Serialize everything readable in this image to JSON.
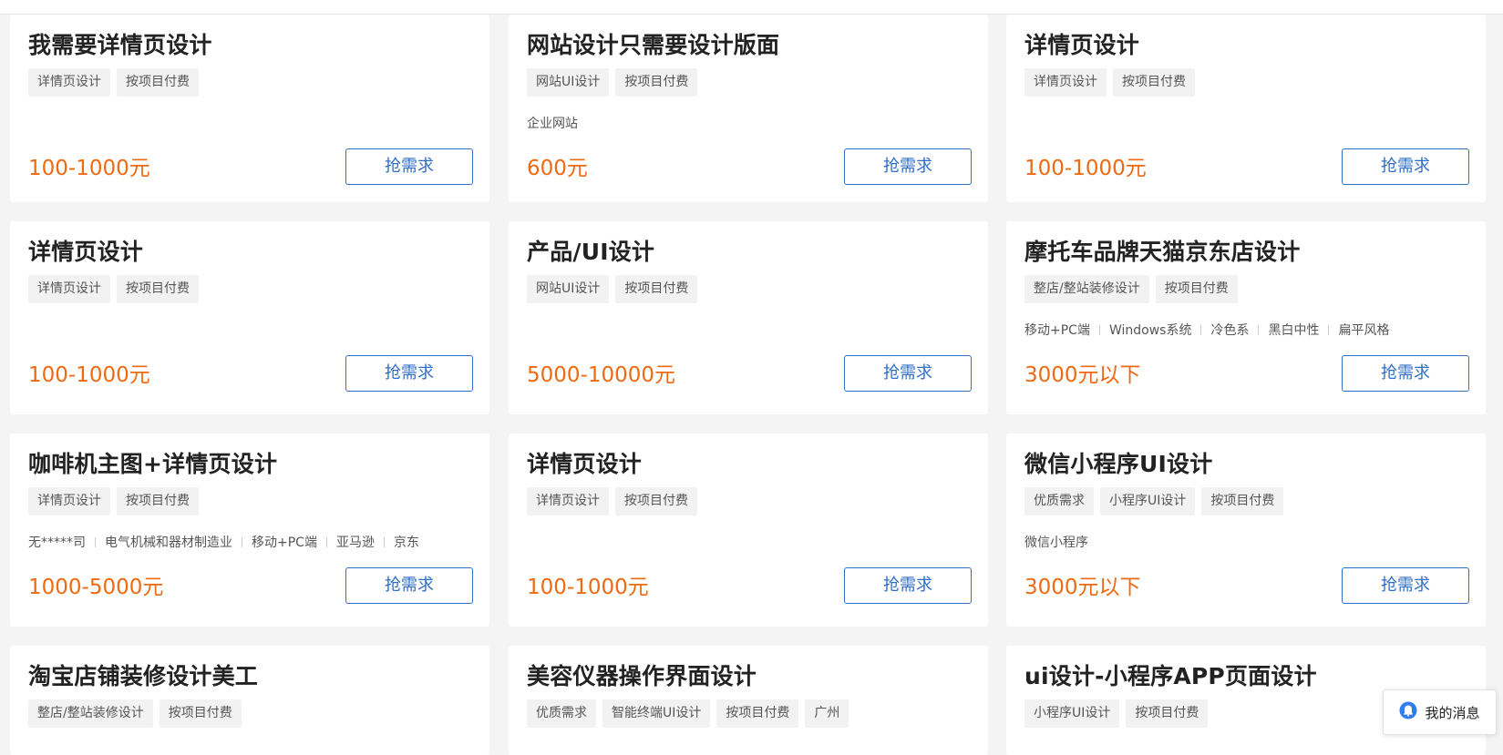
{
  "grab_label": "抢需求",
  "cards": [
    {
      "title": "我需要详情页设计",
      "tags": [
        "详情页设计",
        "按项目付费"
      ],
      "info": [],
      "price": "100-1000元"
    },
    {
      "title": "网站设计只需要设计版面",
      "tags": [
        "网站UI设计",
        "按项目付费"
      ],
      "info": [
        "企业网站"
      ],
      "price": "600元"
    },
    {
      "title": "详情页设计",
      "tags": [
        "详情页设计",
        "按项目付费"
      ],
      "info": [],
      "price": "100-1000元"
    },
    {
      "title": "详情页设计",
      "tags": [
        "详情页设计",
        "按项目付费"
      ],
      "info": [],
      "price": "100-1000元"
    },
    {
      "title": "产品/UI设计",
      "tags": [
        "网站UI设计",
        "按项目付费"
      ],
      "info": [],
      "price": "5000-10000元"
    },
    {
      "title": "摩托车品牌天猫京东店设计",
      "tags": [
        "整店/整站装修设计",
        "按项目付费"
      ],
      "info": [
        "移动+PC端",
        "Windows系统",
        "冷色系",
        "黑白中性",
        "扁平风格"
      ],
      "price": "3000元以下"
    },
    {
      "title": "咖啡机主图+详情页设计",
      "tags": [
        "详情页设计",
        "按项目付费"
      ],
      "info": [
        "无*****司",
        "电气机械和器材制造业",
        "移动+PC端",
        "亚马逊",
        "京东"
      ],
      "price": "1000-5000元"
    },
    {
      "title": "详情页设计",
      "tags": [
        "详情页设计",
        "按项目付费"
      ],
      "info": [],
      "price": "100-1000元"
    },
    {
      "title": "微信小程序UI设计",
      "tags": [
        "优质需求",
        "小程序UI设计",
        "按项目付费"
      ],
      "info": [
        "微信小程序"
      ],
      "price": "3000元以下"
    },
    {
      "title": "淘宝店铺装修设计美工",
      "tags": [
        "整店/整站装修设计",
        "按项目付费"
      ],
      "info": [],
      "price": ""
    },
    {
      "title": "美容仪器操作界面设计",
      "tags": [
        "优质需求",
        "智能终端UI设计",
        "按项目付费",
        "广州"
      ],
      "info": [],
      "price": ""
    },
    {
      "title": "ui设计-小程序APP页面设计",
      "tags": [
        "小程序UI设计",
        "按项目付费"
      ],
      "info": [],
      "price": ""
    }
  ],
  "messages": {
    "label": "我的消息",
    "icon": "chat-bubble-icon"
  },
  "colors": {
    "accent": "#2f6ec6",
    "price": "#ee6a12",
    "tag_bg": "#f2f2f2",
    "page_bg": "#f4f4f4"
  }
}
